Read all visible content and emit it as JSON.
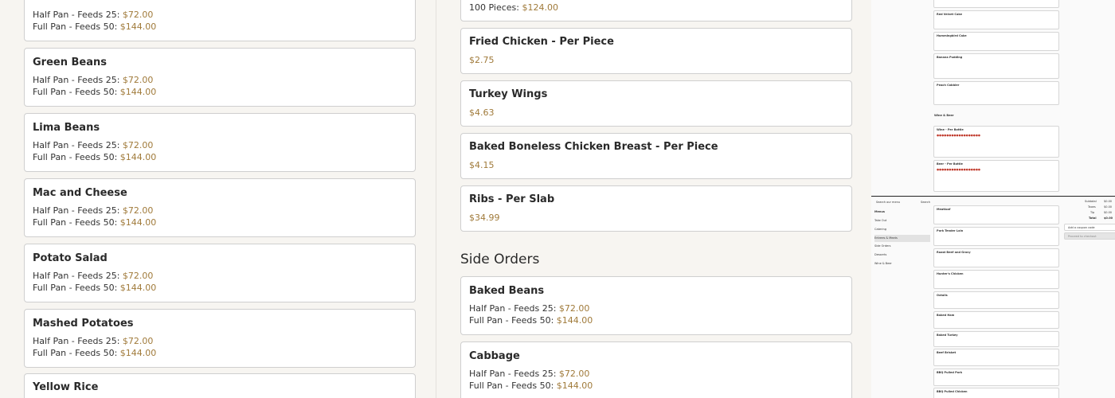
{
  "left_cards": [
    {
      "title": "",
      "lines": [
        {
          "label": "Half Pan - Feeds 25: ",
          "price": "$72.00"
        },
        {
          "label": "Full Pan - Feeds 50: ",
          "price": "$144.00"
        }
      ]
    },
    {
      "title": "Green Beans",
      "lines": [
        {
          "label": "Half Pan - Feeds 25: ",
          "price": "$72.00"
        },
        {
          "label": "Full Pan - Feeds 50: ",
          "price": "$144.00"
        }
      ]
    },
    {
      "title": "Lima Beans",
      "lines": [
        {
          "label": "Half Pan - Feeds 25: ",
          "price": "$72.00"
        },
        {
          "label": "Full Pan - Feeds 50: ",
          "price": "$144.00"
        }
      ]
    },
    {
      "title": "Mac and Cheese",
      "lines": [
        {
          "label": "Half Pan - Feeds 25: ",
          "price": "$72.00"
        },
        {
          "label": "Full Pan - Feeds 50: ",
          "price": "$144.00"
        }
      ]
    },
    {
      "title": "Potato Salad",
      "lines": [
        {
          "label": "Half Pan - Feeds 25: ",
          "price": "$72.00"
        },
        {
          "label": "Full Pan - Feeds 50: ",
          "price": "$144.00"
        }
      ]
    },
    {
      "title": "Mashed Potatoes",
      "lines": [
        {
          "label": "Half Pan - Feeds 25: ",
          "price": "$72.00"
        },
        {
          "label": "Full Pan - Feeds 50: ",
          "price": "$144.00"
        }
      ]
    },
    {
      "title": "Yellow Rice",
      "lines": []
    }
  ],
  "mid_cards": [
    {
      "title": "",
      "lines": [
        {
          "label": "100 Pieces: ",
          "price": "$124.00"
        }
      ]
    },
    {
      "title": "Fried Chicken - Per Piece",
      "lines": [
        {
          "label": "",
          "price": "$2.75"
        }
      ]
    },
    {
      "title": "Turkey Wings",
      "lines": [
        {
          "label": "",
          "price": "$4.63"
        }
      ]
    },
    {
      "title": "Baked Boneless Chicken Breast - Per Piece",
      "lines": [
        {
          "label": "",
          "price": "$4.15"
        }
      ]
    },
    {
      "title": "Ribs - Per Slab",
      "lines": [
        {
          "label": "",
          "price": "$34.99"
        }
      ]
    }
  ],
  "side_orders": {
    "heading": "Side Orders",
    "cards": [
      {
        "title": "Baked Beans",
        "lines": [
          {
            "label": "Half Pan - Feeds 25: ",
            "price": "$72.00"
          },
          {
            "label": "Full Pan - Feeds 50: ",
            "price": "$144.00"
          }
        ]
      },
      {
        "title": "Cabbage",
        "lines": [
          {
            "label": "Half Pan - Feeds 25: ",
            "price": "$72.00"
          },
          {
            "label": "Full Pan - Feeds 50: ",
            "price": "$144.00"
          }
        ]
      }
    ]
  },
  "thumbnail": {
    "top_items": [
      "Red Velvet Cake",
      "Hummingbird Cake",
      "Banana Pudding",
      "Peach Cobbler",
      "Wine & Beer",
      "Wine - Per Bottle",
      "Beer - Per Bottle"
    ],
    "nav_items": [
      "Menus",
      "Take Out",
      "Catering",
      "Entrees & Meats",
      "Side Orders",
      "Desserts",
      "Wine & Beer"
    ],
    "search_placeholder": "Search our menu",
    "search_label": "Search",
    "bottom_items": [
      "Meatloaf",
      "Pork Tender Loin",
      "Roast Beef and Gravy",
      "Hunter's Chicken",
      "Oxtails",
      "Baked Ham",
      "Baked Turkey",
      "Beef Brisket",
      "BBQ Pulled Pork",
      "BBQ Pulled Chicken"
    ],
    "summary_labels": [
      "Subtotal",
      "Taxes",
      "Tip",
      "Total"
    ],
    "summary_values": [
      "$0.00",
      "$0.00",
      "$0.00",
      "$0.00"
    ],
    "coupon_label": "Add a coupon code",
    "checkout_label": "Proceed to checkout"
  },
  "colors": {
    "price": "#a07a3a",
    "card_border": "#cfcfcf",
    "background": "#f7f5f1"
  }
}
